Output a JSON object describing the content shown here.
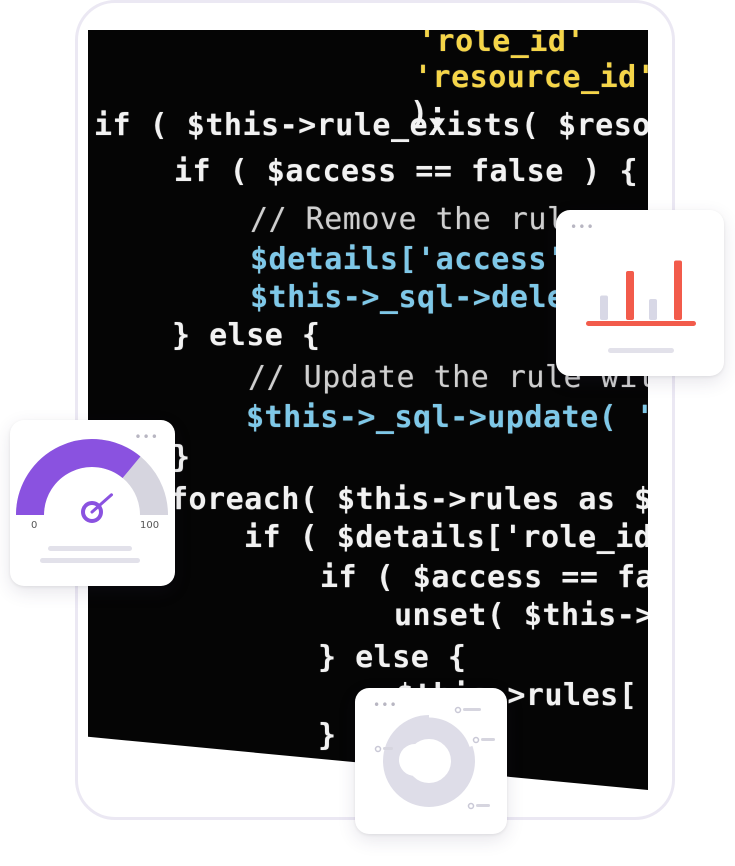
{
  "code_lines": [
    "'role_id'",
    "'resource_id'",
    ");",
    "if ( $this->rule_exists( $reso",
    "if ( $access == false ) {",
    "// Remove the rul",
    "$details['access'",
    "$this->_sql->dele",
    "} else {",
    "// Update the rule wit",
    "$this->_sql->update( '",
    "}",
    "foreach( $this->rules as $",
    "if ( $details['role_id",
    "if ( $access == fa",
    "unset( $this->",
    "} else {",
    "$this->rules[ $",
    "}"
  ],
  "bar_widget": {
    "dots": "•••",
    "bars": [
      0.35,
      0.7,
      0.3,
      0.85
    ],
    "accent": "#f25b4b",
    "muted": "#d8d8e6"
  },
  "gauge_widget": {
    "dots": "•••",
    "min_label": "0",
    "max_label": "100",
    "value": 0.72,
    "accent": "#8a52e0"
  },
  "donut_widget": {
    "dots": "•••",
    "muted": "#dedde8"
  }
}
